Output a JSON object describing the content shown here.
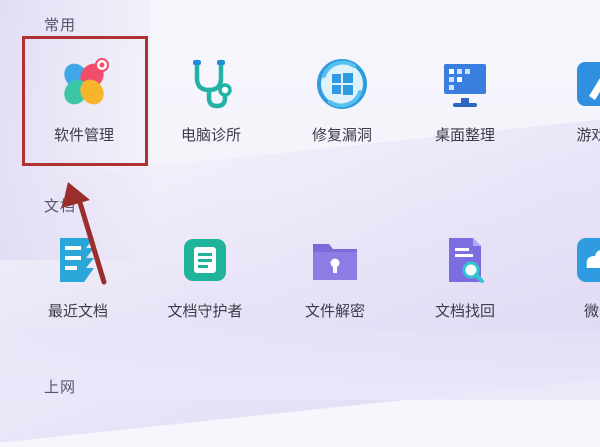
{
  "sections": {
    "common": "常用",
    "docs": "文档",
    "web": "上网"
  },
  "common_items": [
    {
      "label": "软件管理",
      "icon": "software-manager-icon"
    },
    {
      "label": "电脑诊所",
      "icon": "stethoscope-icon"
    },
    {
      "label": "修复漏洞",
      "icon": "windows-repair-icon"
    },
    {
      "label": "桌面整理",
      "icon": "desktop-monitor-icon"
    },
    {
      "label": "游戏加",
      "icon": "game-accelerator-icon"
    }
  ],
  "doc_items": [
    {
      "label": "最近文档",
      "icon": "recent-documents-icon"
    },
    {
      "label": "文档守护者",
      "icon": "document-guardian-icon"
    },
    {
      "label": "文件解密",
      "icon": "folder-lock-icon"
    },
    {
      "label": "文档找回",
      "icon": "document-search-icon"
    },
    {
      "label": "微云",
      "icon": "weiyun-cloud-icon"
    }
  ],
  "colors": {
    "highlight": "#b0312f",
    "arrow": "#9a2e2c",
    "accent_blue": "#2f8fe0",
    "accent_teal": "#22b3a6",
    "accent_purple": "#7b6ad8"
  }
}
